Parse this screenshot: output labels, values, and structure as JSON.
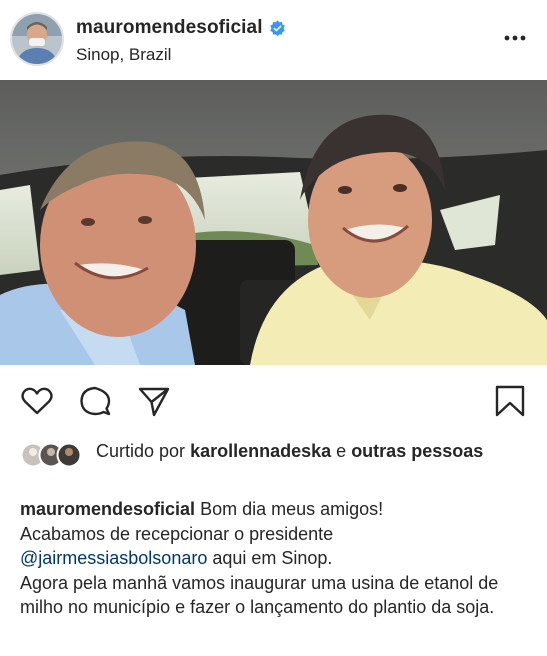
{
  "post": {
    "username": "mauromendesoficial",
    "location": "Sinop, Brazil"
  },
  "likes": {
    "prefix": "Curtido por",
    "user": "karollennadeska",
    "connector": "e",
    "suffix": "outras pessoas"
  },
  "caption": {
    "username": "mauromendesoficial",
    "line1": "Bom dia meus amigos!",
    "line2": "Acabamos de recepcionar o presidente",
    "mention": "@jairmessiasbolsonaro",
    "line3_rest": " aqui em Sinop.",
    "para2": "Agora pela manhã vamos inaugurar uma usina de etanol de milho no município e fazer o lançamento do plantio da soja."
  },
  "colors": {
    "verified_badge": "#3897f0",
    "mention": "#00376b",
    "text": "#262626"
  },
  "icons": [
    "verified-badge-icon",
    "more-options-icon",
    "heart-icon",
    "comment-icon",
    "share-icon",
    "bookmark-icon"
  ]
}
